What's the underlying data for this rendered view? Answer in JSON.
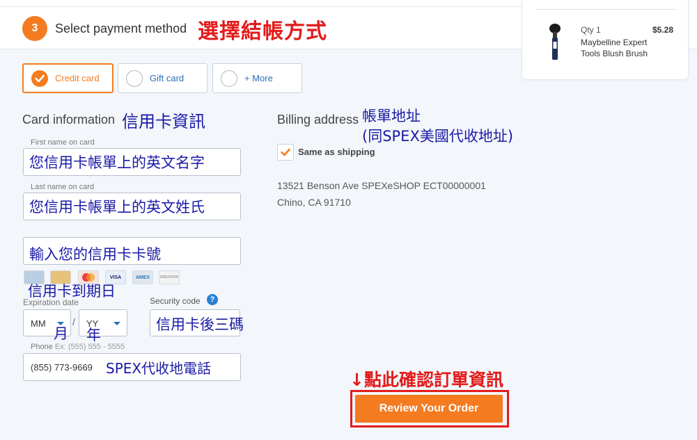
{
  "header": {
    "step_number": "3",
    "step_title": "Select payment method",
    "step_annotation": "選擇結帳方式"
  },
  "order_summary": {
    "qty": "Qty 1",
    "price": "$5.28",
    "product_name": "Maybelline Expert Tools Blush Brush"
  },
  "payment_methods": [
    {
      "label": "Credit card",
      "selected": true
    },
    {
      "label": "Gift card",
      "selected": false
    },
    {
      "label": "+ More",
      "selected": false
    }
  ],
  "card_info": {
    "title": "Card information",
    "title_annotation": "信用卡資訊",
    "first_name_label": "First name on card",
    "first_name_annotation": "您信用卡帳單上的英文名字",
    "last_name_label": "Last name on card",
    "last_name_annotation": "您信用卡帳單上的英文姓氏",
    "card_number_annotation": "輸入您的信用卡卡號",
    "card_brands": [
      "generic",
      "generic-gold",
      "mastercard",
      "visa",
      "amex",
      "discover"
    ],
    "brand_text": {
      "mastercard": "MC",
      "visa": "VISA",
      "amex": "AMEX",
      "discover": "DISCOVER"
    },
    "expiration_annotation": "信用卡到期日",
    "expiration_label": "Expiration date",
    "month_value": "MM",
    "year_value": "YY",
    "separator": "/",
    "month_annotation": "月",
    "year_annotation": "年",
    "security_label": "Security code",
    "security_help": "?",
    "security_annotation": "信用卡後三碼",
    "phone_label": "Phone",
    "phone_hint": "Ex: (555) 555 - 5555",
    "phone_value": "(855) 773-9669",
    "phone_annotation": "SPEX代收地電話"
  },
  "billing": {
    "title": "Billing address",
    "title_annotation_line1": "帳單地址",
    "title_annotation_line2": "(同SPEX美國代收地址)",
    "same_as_shipping": "Same as shipping",
    "address_line1": "13521 Benson Ave SPEXeSHOP ECT00000001",
    "address_line2": "Chino, CA 91710"
  },
  "review": {
    "annotation": "↓點此確認訂單資訊",
    "button_label": "Review Your Order"
  },
  "colors": {
    "accent": "#f47b20",
    "link_blue": "#2a6ebb",
    "annotation_red": "#e31b1b",
    "annotation_blue": "#1a1aa6"
  }
}
